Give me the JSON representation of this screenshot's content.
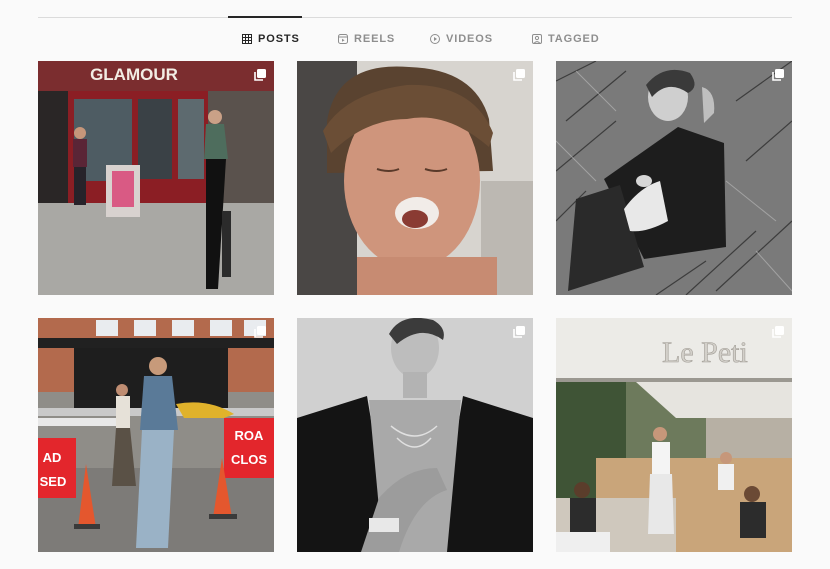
{
  "tabs": [
    {
      "label": "POSTS",
      "icon": "grid-icon",
      "active": true
    },
    {
      "label": "REELS",
      "icon": "reels-icon",
      "active": false
    },
    {
      "label": "VIDEOS",
      "icon": "video-icon",
      "active": false
    },
    {
      "label": "TAGGED",
      "icon": "tagged-icon",
      "active": false
    }
  ],
  "posts": [
    {
      "sign_text": "GLAMOUR",
      "badge": "multiple-photos-icon"
    },
    {
      "badge": "multiple-photos-icon"
    },
    {
      "badge": "multiple-photos-icon"
    },
    {
      "sign_text_1": "ROA",
      "sign_text_2": "CLOS",
      "sign_text_3": "AD",
      "sign_text_4": "SED",
      "badge": "multiple-photos-icon"
    },
    {
      "badge": "multiple-photos-icon"
    },
    {
      "sign_text": "Le Peti",
      "badge": "multiple-photos-icon"
    }
  ],
  "colors": {
    "accent": "#262626",
    "muted": "#8e8e8e",
    "divider": "#dbdbdb",
    "background": "#fafafa"
  }
}
